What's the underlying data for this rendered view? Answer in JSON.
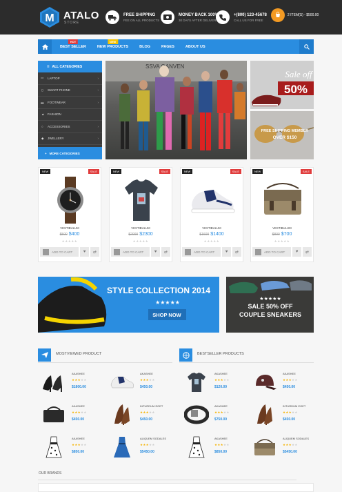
{
  "brand": {
    "name": "ATALO",
    "sub": "STORE",
    "logo_letter": "M"
  },
  "header_features": [
    {
      "icon": "truck-icon",
      "title": "FREE SHIPPING",
      "sub": "FEE ON ALL PRODUCTS"
    },
    {
      "icon": "money-icon",
      "title": "MONEY BACK 100%",
      "sub": "30 DAYS AFTER DELIVERY"
    },
    {
      "icon": "phone-icon",
      "title": "+(800) 123-45678",
      "sub": "CALL US FOR FREE"
    }
  ],
  "cart": {
    "text": "2 ITEM(S) - $500.00"
  },
  "nav": {
    "items": [
      {
        "label": "BEST SELLER",
        "badge": "HOT",
        "badge_color": "#e03c3c"
      },
      {
        "label": "NEW PRODUCTS",
        "badge": "NEW",
        "badge_color": "#f5c200"
      },
      {
        "label": "BLOG"
      },
      {
        "label": "PAGES"
      },
      {
        "label": "ABOUT US"
      }
    ]
  },
  "categories": {
    "header": "ALL CATEGORIES",
    "items": [
      "LAPTOP",
      "SMART PHONE",
      "FOOTWEAR",
      "FASHION",
      "ACCESSORIES",
      "JWELLERY"
    ],
    "footer": "MORE CATEGORIES"
  },
  "hero": {
    "caption": "SSVA GANVEN"
  },
  "side_banners": {
    "sale_text": "Sale off",
    "sale_pct": "50%",
    "ship_line1": "FREE SHIPPING MEMBER",
    "ship_line2": "OVER $150"
  },
  "products": [
    {
      "name": "VESTIBULUM",
      "old": "$500",
      "price": "$400",
      "img": "watch",
      "add": "ADD TO CART"
    },
    {
      "name": "VESTIBULUM",
      "old": "$2000",
      "price": "$2300",
      "img": "tshirt",
      "add": "ADD TO CART"
    },
    {
      "name": "VESTIBULUM",
      "old": "$1600",
      "price": "$1400",
      "img": "sneaker",
      "add": "ADD TO CART"
    },
    {
      "name": "VESTIBULUM",
      "old": "$800",
      "price": "$700",
      "img": "bag",
      "add": "ADD TO CART"
    }
  ],
  "product_badges": {
    "new": "NEW",
    "sale": "SALE"
  },
  "banner_collection": {
    "title": "STYLE COLLECTION 2014",
    "button": "SHOP NOW"
  },
  "banner_sneakers": {
    "line1": "SALE 50% OFF",
    "line2": "COUPLE SNEAKERS"
  },
  "mostviewed": {
    "title": "MOSTVIEWED PRODUCT",
    "items": [
      {
        "name": "AKASHEE",
        "price": "$1800.00",
        "img": "heels-black"
      },
      {
        "name": "AKASHEE",
        "price": "$450.00",
        "img": "sneaker"
      },
      {
        "name": "AKASHEE",
        "price": "$450.00",
        "img": "bag-dark"
      },
      {
        "name": "INTURDUM EGET",
        "price": "$450.00",
        "img": "heels-brown"
      },
      {
        "name": "AKASHEE",
        "price": "$850.00",
        "img": "dress-polka"
      },
      {
        "name": "ALIQUEM SODALES",
        "price": "$5450.00",
        "img": "dress-blue"
      }
    ]
  },
  "bestseller": {
    "title": "BESTSELLER PRODUCTS",
    "items": [
      {
        "name": "AKASHEE",
        "price": "$120.00",
        "img": "tshirt"
      },
      {
        "name": "AKASHEE",
        "price": "$450.00",
        "img": "cap"
      },
      {
        "name": "AKASHEE",
        "price": "$750.00",
        "img": "belt"
      },
      {
        "name": "INTURDUM EGET",
        "price": "$450.00",
        "img": "heels-brown"
      },
      {
        "name": "AKASHEE",
        "price": "$850.00",
        "img": "dress-polka"
      },
      {
        "name": "ALIQUEM SODALES",
        "price": "$5450.00",
        "img": "bag"
      }
    ]
  },
  "brands": {
    "title": "OUR BRANDS"
  },
  "colors": {
    "accent": "#2a8de0",
    "dark": "#2c2c2c",
    "cart": "#f39a23",
    "sale": "#e03c3c"
  }
}
